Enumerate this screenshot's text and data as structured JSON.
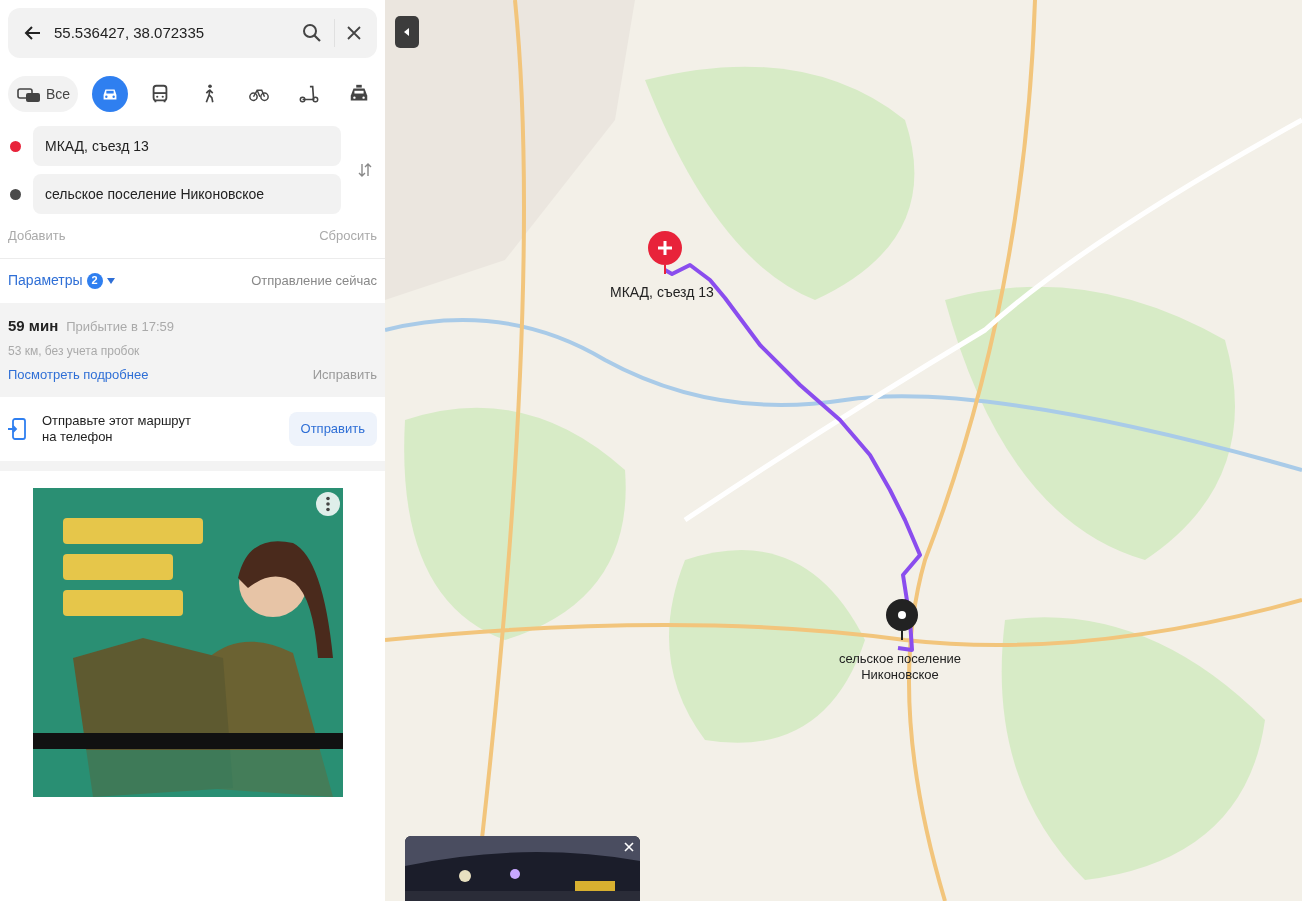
{
  "search": {
    "value": "55.536427, 38.072335"
  },
  "transport_modes": [
    {
      "kind": "all",
      "label": "Все",
      "selected": false
    },
    {
      "kind": "car",
      "selected": true
    },
    {
      "kind": "bus",
      "selected": false
    },
    {
      "kind": "walk",
      "selected": false
    },
    {
      "kind": "bike",
      "selected": false
    },
    {
      "kind": "scooter",
      "selected": false
    },
    {
      "kind": "taxi",
      "selected": false
    }
  ],
  "waypoints": [
    {
      "value": "МКАД, съезд 13",
      "color": "#e8233a"
    },
    {
      "value": "сельское поселение Никоновское",
      "color": "#4a4a4a"
    }
  ],
  "add_label": "Добавить",
  "reset_label": "Сбросить",
  "parameters": {
    "label": "Параметры",
    "count": "2",
    "departure": "Отправление сейчас"
  },
  "route": {
    "duration": "59 мин",
    "arrival": "Прибытие в 17:59",
    "distance": "53 км, без учета пробок",
    "details_link": "Посмотреть подробнее",
    "fix_link": "Исправить"
  },
  "send": {
    "text": "Отправьте этот маршрут на телефон",
    "button": "Отправить"
  },
  "map": {
    "start_label": "МКАД, съезд 13",
    "end_label": "сельское поселение Никоновское"
  }
}
